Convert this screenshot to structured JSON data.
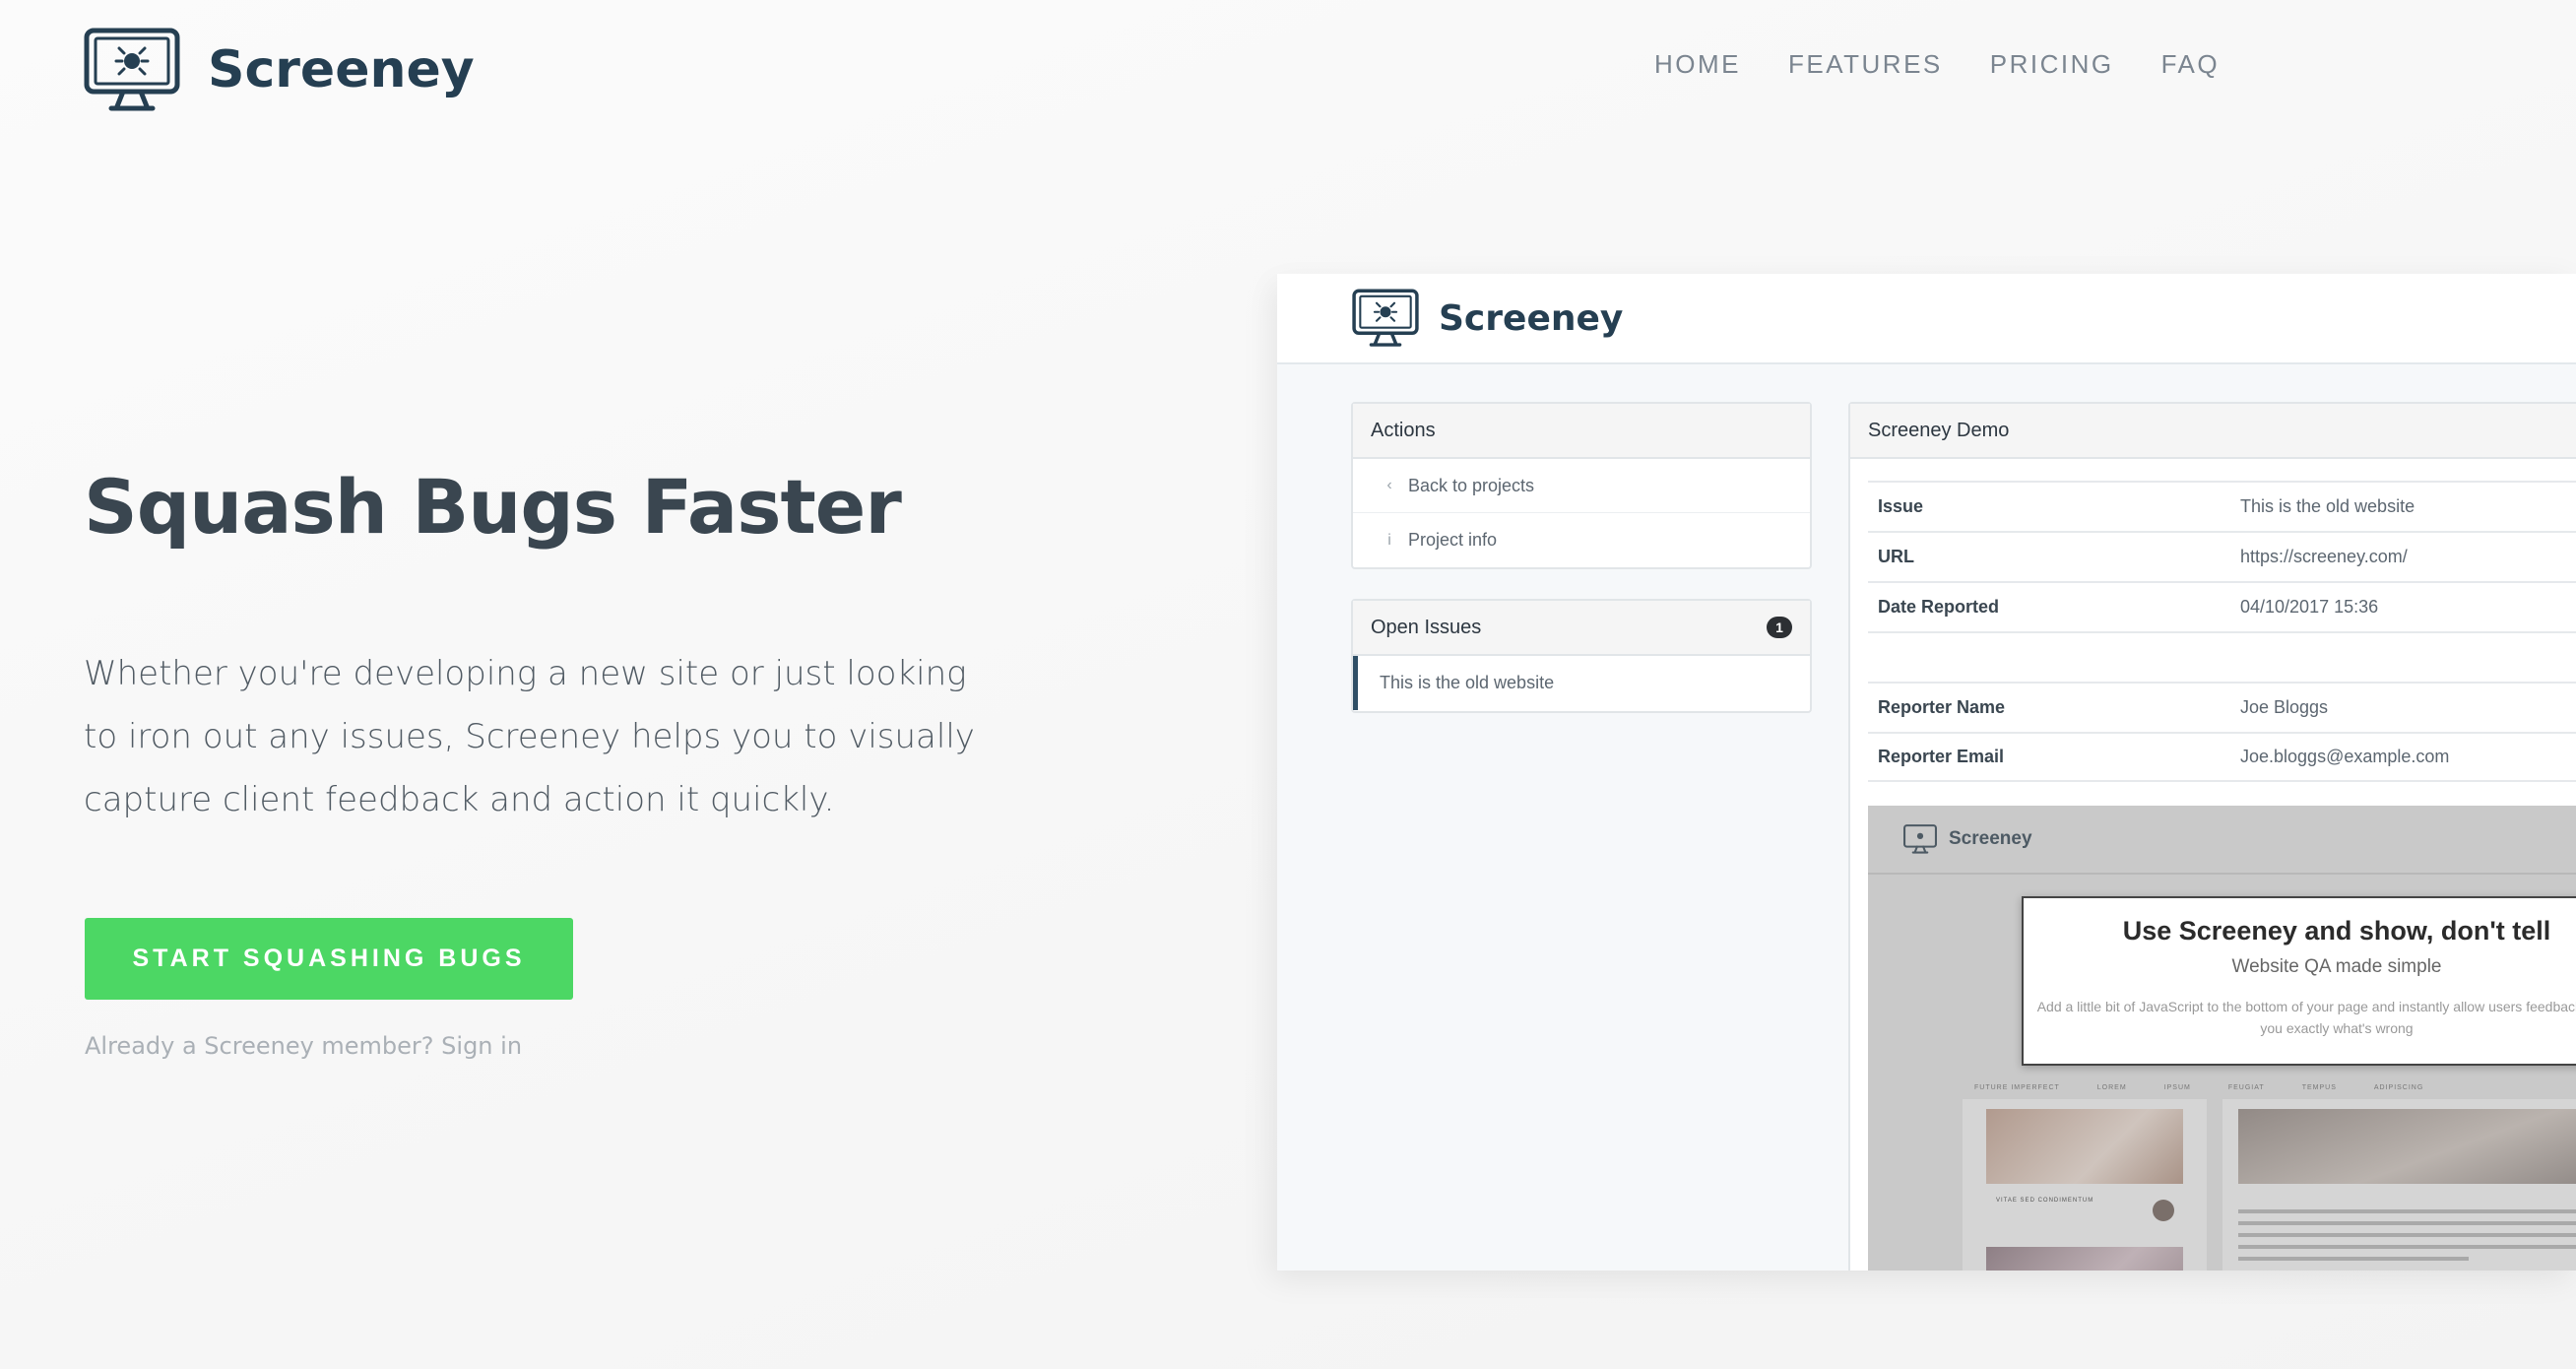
{
  "brand": {
    "name": "Screeney",
    "color": "#253f52"
  },
  "nav": {
    "items": [
      "HOME",
      "FEATURES",
      "PRICING",
      "FAQ"
    ]
  },
  "hero": {
    "title": "Squash Bugs Faster",
    "description": "Whether you're developing a new site or just looking to iron out any issues, Screeney helps you to visually capture client feedback and action it quickly.",
    "cta_label": "START SQUASHING BUGS",
    "cta_color": "#4cd764",
    "signin_text": "Already a Screeney member? Sign in"
  },
  "preview": {
    "brand": "Screeney",
    "actions": {
      "title": "Actions",
      "items": [
        {
          "icon": "chevron-left-icon",
          "label": "Back to projects"
        },
        {
          "icon": "info-icon",
          "label": "Project info"
        }
      ]
    },
    "open_issues": {
      "title": "Open Issues",
      "count": "1",
      "items": [
        "This is the old website"
      ]
    },
    "detail": {
      "title": "Screeney Demo",
      "rows": [
        {
          "key": "Issue",
          "value": "This is the old website"
        },
        {
          "key": "URL",
          "value": "https://screeney.com/"
        },
        {
          "key": "Date Reported",
          "value": "04/10/2017 15:36"
        },
        {
          "key": "",
          "value": ""
        },
        {
          "key": "Reporter Name",
          "value": "Joe Bloggs"
        },
        {
          "key": "Reporter Email",
          "value": "Joe.bloggs@example.com"
        }
      ]
    },
    "screenshot": {
      "brand": "Screeney",
      "headline": "Use Screeney and show, don't tell",
      "subheadline": "Website QA made simple",
      "body": "Add a little bit of JavaScript to the bottom of your page and instantly allow users feedback showing you exactly what's wrong",
      "nav": [
        "FUTURE IMPERFECT",
        "LOREM",
        "IPSUM",
        "FEUGIAT",
        "TEMPUS",
        "ADIPISCING"
      ],
      "post_title": "VITAE SED CONDIMENTUM"
    }
  }
}
